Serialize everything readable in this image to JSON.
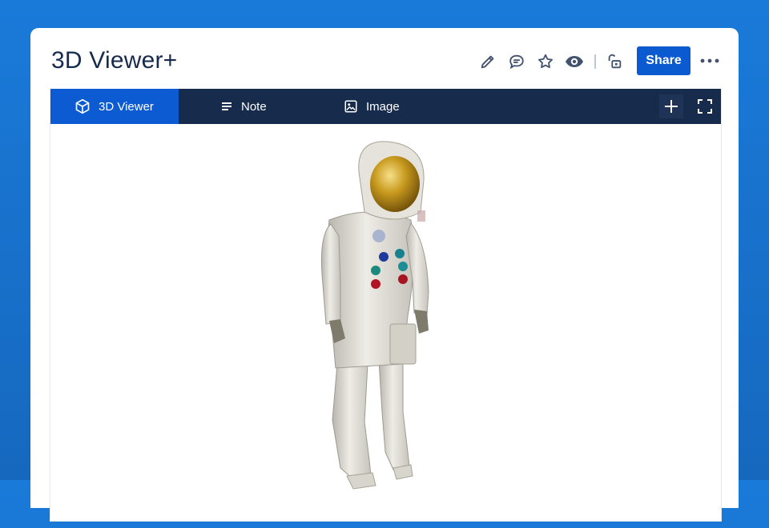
{
  "page": {
    "title": "3D Viewer+"
  },
  "header": {
    "share_label": "Share"
  },
  "icons": {
    "edit": "pencil-icon",
    "comment": "comment-icon",
    "star": "star-icon",
    "watch": "eye-icon",
    "restrictions": "unlock-icon",
    "more": "more-icon"
  },
  "tabs": [
    {
      "label": "3D Viewer",
      "icon": "cube-icon",
      "active": true
    },
    {
      "label": "Note",
      "icon": "lines-icon",
      "active": false
    },
    {
      "label": "Image",
      "icon": "image-icon",
      "active": false
    }
  ],
  "tools": {
    "add": "plus-icon",
    "fullscreen": "fullscreen-icon"
  },
  "colors": {
    "background": "#1a7ad9",
    "accent": "#0c5bd3",
    "tabbar": "#172b4d",
    "text": "#172b4d"
  }
}
